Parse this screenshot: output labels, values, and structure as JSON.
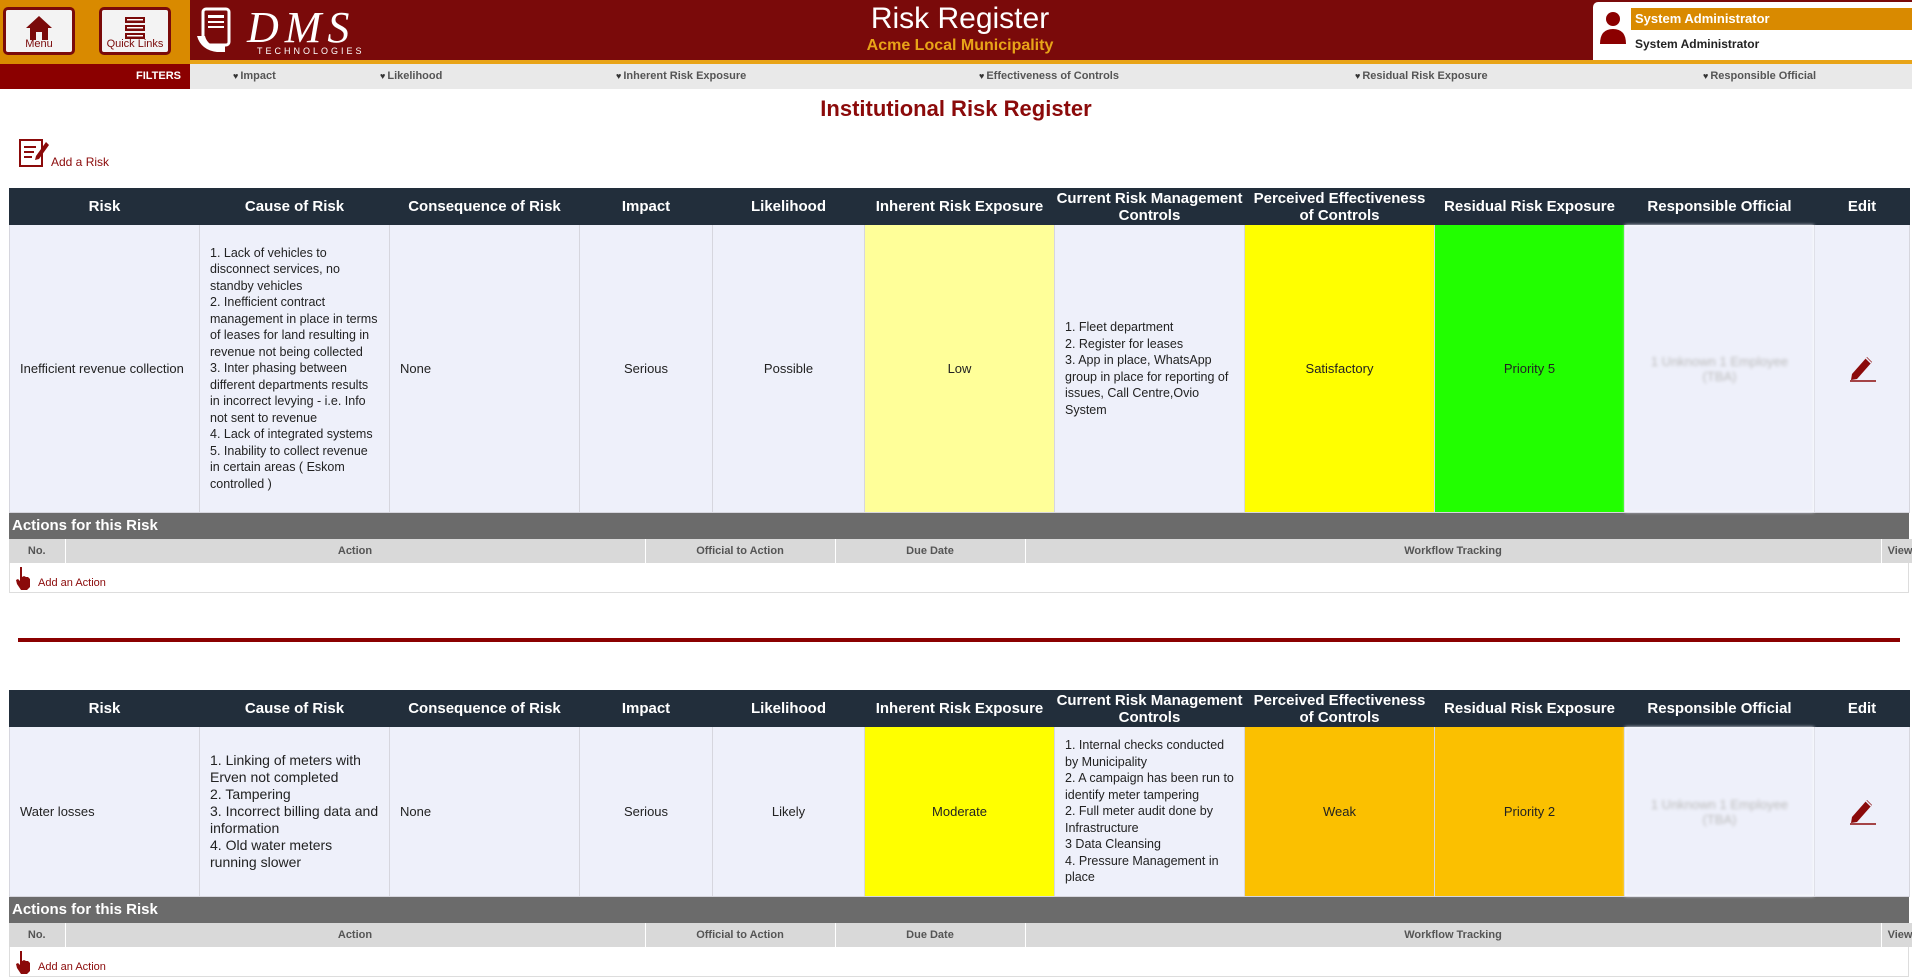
{
  "header": {
    "menu_label": "Menu",
    "quicklinks_label": "Quick Links",
    "logo_text": "DMS",
    "logo_subtext": "TECHNOLOGIES",
    "title": "Risk Register",
    "subtitle": "Acme Local Municipality",
    "user_role": "System Administrator",
    "user_name": "System Administrator"
  },
  "filters": {
    "label": "FILTERS",
    "items": [
      "Impact",
      "Likelihood",
      "Inherent Risk Exposure",
      "Effectiveness of Controls",
      "Residual Risk Exposure",
      "Responsible Official"
    ]
  },
  "page_title": "Institutional Risk Register",
  "add_risk_label": "Add a Risk",
  "columns": [
    "Risk",
    "Cause of Risk",
    "Consequence of Risk",
    "Impact",
    "Likelihood",
    "Inherent Risk Exposure",
    "Current Risk Management Controls",
    "Perceived Effectiveness of Controls",
    "Residual Risk Exposure",
    "Responsible Official",
    "Edit"
  ],
  "actions_header": "Actions for this Risk",
  "action_columns": [
    "No.",
    "Action",
    "Official to Action",
    "Due Date",
    "Workflow Tracking",
    "View"
  ],
  "add_action_label": "Add an Action",
  "risks": [
    {
      "risk": "Inefficient revenue collection",
      "cause": [
        "1. Lack of vehicles to disconnect services, no standby vehicles",
        "2. Inefficient contract management in place in terms of leases for land resulting in revenue not being collected",
        "3. Inter phasing between different departments results in incorrect levying - i.e. Info not sent to revenue",
        "4. Lack of integrated systems",
        "5. Inability to collect revenue in certain areas ( Eskom controlled )"
      ],
      "consequence": "None",
      "impact": "Serious",
      "likelihood": "Possible",
      "inherent": "Low",
      "inherent_color": "#ffff99",
      "controls": [
        "1. Fleet department",
        "2. Register for leases",
        "3. App in place, WhatsApp group in place for reporting of issues, Call Centre,Ovio System"
      ],
      "effectiveness": "Satisfactory",
      "effectiveness_color": "#ffff00",
      "residual": "Priority 5",
      "residual_color": "#22ff00",
      "official": "1 Unknown 1 Employee (TBA)"
    },
    {
      "risk": "Water losses",
      "cause": [
        "1. Linking of meters with Erven not completed",
        "2. Tampering",
        "3. Incorrect billing data and information",
        "4. Old water meters running slower"
      ],
      "consequence": "None",
      "impact": "Serious",
      "likelihood": "Likely",
      "inherent": "Moderate",
      "inherent_color": "#ffff00",
      "controls": [
        "1. Internal checks conducted by Municipality",
        "2. A campaign has been run to identify meter tampering",
        "2. Full meter audit done by Infrastructure",
        "3 Data Cleansing",
        "4. Pressure Management in place"
      ],
      "effectiveness": "Weak",
      "effectiveness_color": "#fbc000",
      "residual": "Priority 2",
      "residual_color": "#fbc000",
      "official": "1 Unknown 1 Employee (TBA)"
    }
  ]
}
